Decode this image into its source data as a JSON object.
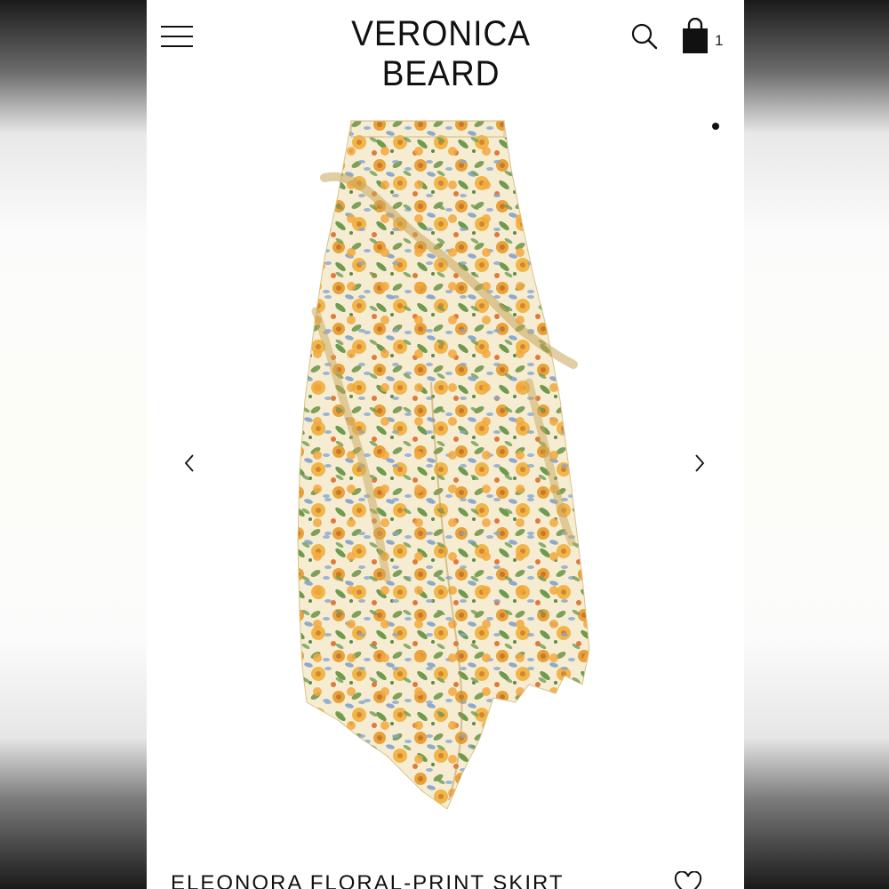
{
  "header": {
    "brand": "VERONICA BEARD",
    "cart_count": "1",
    "menu_icon": "hamburger-menu-icon",
    "search_icon": "search-icon",
    "cart_icon": "shopping-bag-icon"
  },
  "gallery": {
    "prev_icon": "chevron-left-icon",
    "next_icon": "chevron-right-icon",
    "pagination_dots": 1,
    "active_dot": 1,
    "image_description": "Floral-print asymmetric ruffled midi skirt"
  },
  "product": {
    "name": "ELEONORA FLORAL-PRINT SKIRT",
    "wishlist_icon": "heart-outline-icon"
  },
  "colors": {
    "background": "#ffffff",
    "text": "#111111",
    "print_orange": "#e8a23a",
    "print_green": "#7fa05a",
    "print_blue": "#8fa9c9",
    "print_cream": "#f5ecd2"
  }
}
